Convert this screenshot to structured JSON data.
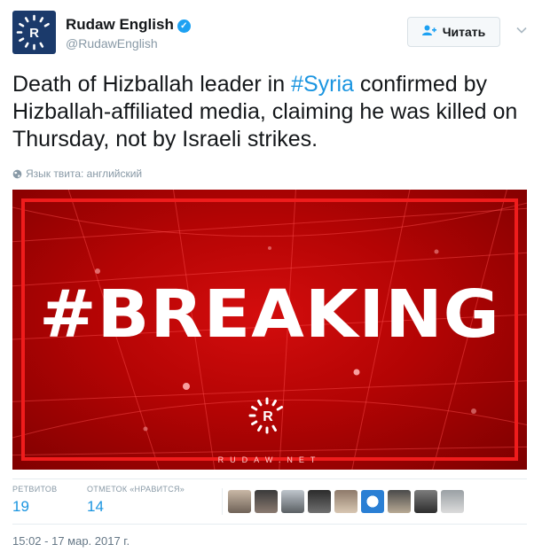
{
  "account": {
    "display_name": "Rudaw English",
    "handle": "@RudawEnglish",
    "follow_label": "Читать",
    "avatar_letter": "R"
  },
  "tweet": {
    "text_before": "Death of Hizballah leader in ",
    "hashtag": "#Syria",
    "text_after": " confirmed by Hizballah-affiliated media, claiming he was killed on Thursday, not by Israeli strikes.",
    "language_note": "Язык твита: английский"
  },
  "media": {
    "headline": "#BREAKING",
    "logo_letter": "R",
    "footer": "RUDAW.NET"
  },
  "stats": {
    "retweets_label": "РЕТВИТОВ",
    "retweets": "19",
    "likes_label": "ОТМЕТОК «НРАВИТСЯ»",
    "likes": "14"
  },
  "timestamp": "15:02 - 17 мар. 2017 г.",
  "colors": {
    "accent": "#1da1f2",
    "hashtag": "#1b95e0",
    "breaking_red": "#c80808",
    "avatar_bg": "#1b3a6b"
  },
  "icons": [
    "verified-badge-icon",
    "person-plus-icon",
    "chevron-down-icon",
    "globe-icon",
    "rudaw-sunburst-logo"
  ]
}
